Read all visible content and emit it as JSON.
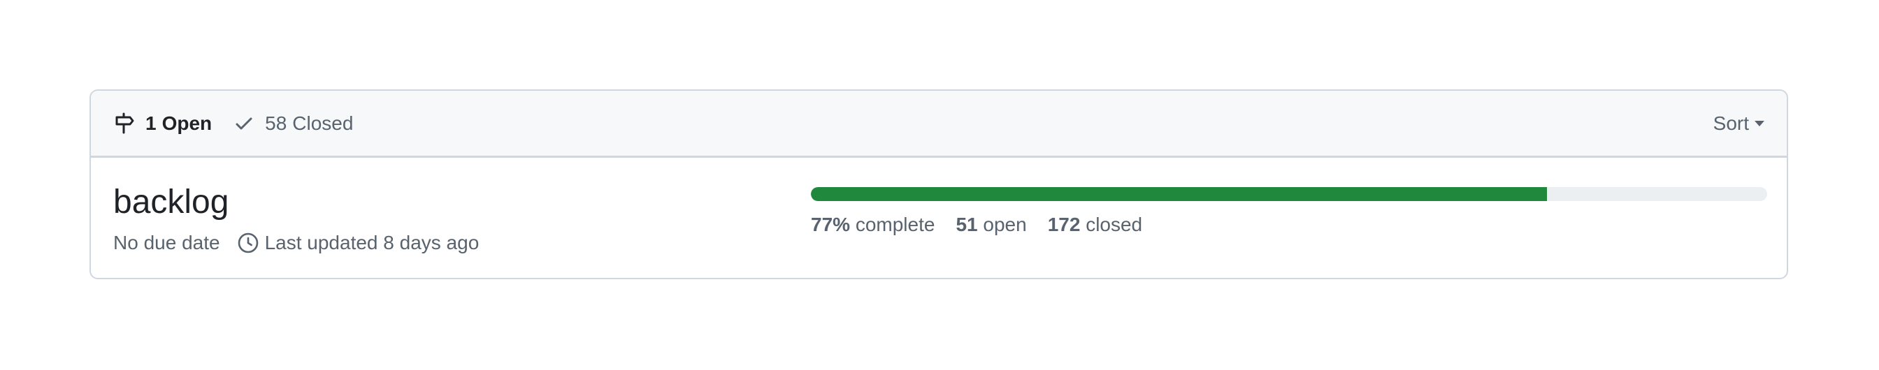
{
  "header": {
    "open_count": "1",
    "open_label": "Open",
    "closed_count": "58",
    "closed_label": "Closed",
    "sort_label": "Sort"
  },
  "milestone": {
    "title": "backlog",
    "due_date": "No due date",
    "last_updated": "Last updated 8 days ago",
    "progress_fraction": 0.77,
    "percent_value": "77%",
    "percent_label": "complete",
    "open_issues": "51",
    "open_label": "open",
    "closed_issues": "172",
    "closed_label": "closed"
  },
  "colors": {
    "progress_fill": "#1f883d",
    "progress_track": "#eceff1",
    "header_bg": "#f6f8fa",
    "border": "#d0d7de",
    "muted_text": "#59636e"
  },
  "icons": {
    "open_state": "milestone-icon",
    "closed_state": "check-icon",
    "sort": "triangle-down-icon",
    "updated": "clock-icon"
  }
}
